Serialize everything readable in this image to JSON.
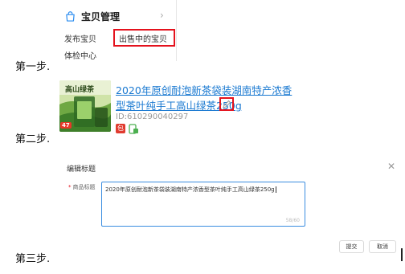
{
  "steps": [
    "第一步.",
    "第二步.",
    "第三步."
  ],
  "menu": {
    "title": "宝贝管理",
    "icon": "shopping-bag-icon",
    "items": [
      "发布宝贝",
      "出售中的宝贝",
      "体检中心"
    ]
  },
  "product": {
    "title_line1": "2020年原创耐泡新茶袋装湖南特产浓香",
    "title_line2": "型茶叶纯手工高山绿茶250g",
    "id_text": "ID:610290040297",
    "thumb_text": "高山绿茶",
    "thumb_badge": "47",
    "tag_red_text": "包"
  },
  "dialog": {
    "title": "编辑标题",
    "field_label_required": "*",
    "field_label": "商品标题",
    "value": "2020年原创耐泡新茶袋装湖南特产浓香型茶叶纯手工高山绿茶250g",
    "counter": "58/60",
    "submit": "提交",
    "cancel": "取消"
  },
  "colors": {
    "highlight": "#e4121d",
    "link": "#1a79d1",
    "input_border": "#3b8de0"
  }
}
